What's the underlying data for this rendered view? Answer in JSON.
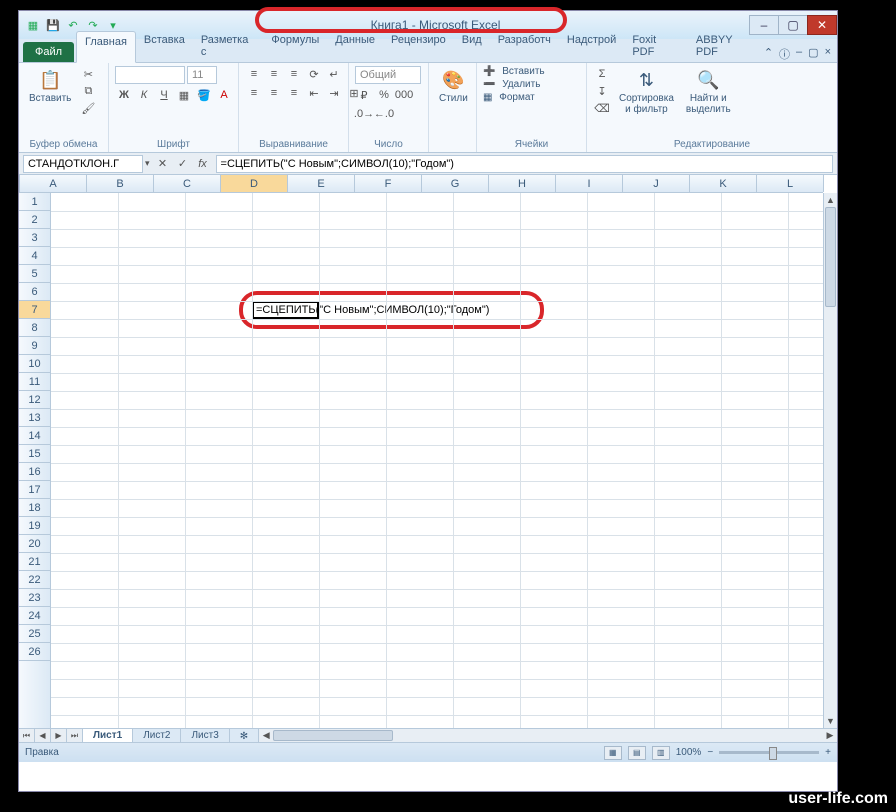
{
  "window": {
    "title": "Книга1 - Microsoft Excel"
  },
  "tabs": {
    "file": "Файл",
    "items": [
      "Главная",
      "Вставка",
      "Разметка с",
      "Формулы",
      "Данные",
      "Рецензиро",
      "Вид",
      "Разработч",
      "Надстрой",
      "Foxit PDF",
      "ABBYY PDF"
    ],
    "active_index": 0
  },
  "ribbon": {
    "clipboard": {
      "label": "Буфер обмена",
      "paste": "Вставить"
    },
    "font": {
      "label": "Шрифт",
      "size": "11"
    },
    "alignment": {
      "label": "Выравнивание"
    },
    "number": {
      "label": "Число",
      "format": "Общий"
    },
    "styles": {
      "label": "",
      "btn": "Стили"
    },
    "cells": {
      "label": "Ячейки",
      "insert": "Вставить",
      "delete": "Удалить",
      "format": "Формат"
    },
    "editing": {
      "label": "Редактирование",
      "sort": "Сортировка\nи фильтр",
      "find": "Найти и\nвыделить"
    }
  },
  "formula_bar": {
    "name_box": "СТАНДОТКЛОН.Г",
    "formula": "=СЦЕПИТЬ(\"С Новым\";СИМВОЛ(10);\"Годом\")"
  },
  "grid": {
    "columns": [
      "A",
      "B",
      "C",
      "D",
      "E",
      "F",
      "G",
      "H",
      "I",
      "J",
      "K",
      "L"
    ],
    "active_col_index": 3,
    "row_count": 26,
    "active_row": 7,
    "active_cell_value": "=СЦЕПИТЬ(\"С Новым\";СИМВОЛ(10);\"Годом\")"
  },
  "sheets": {
    "nav": [
      "⏮",
      "◀",
      "▶",
      "⏭"
    ],
    "items": [
      "Лист1",
      "Лист2",
      "Лист3"
    ],
    "active_index": 0
  },
  "status": {
    "mode": "Правка",
    "zoom": "100%",
    "zoom_minus": "−",
    "zoom_plus": "+"
  },
  "watermark": "user-life.com"
}
